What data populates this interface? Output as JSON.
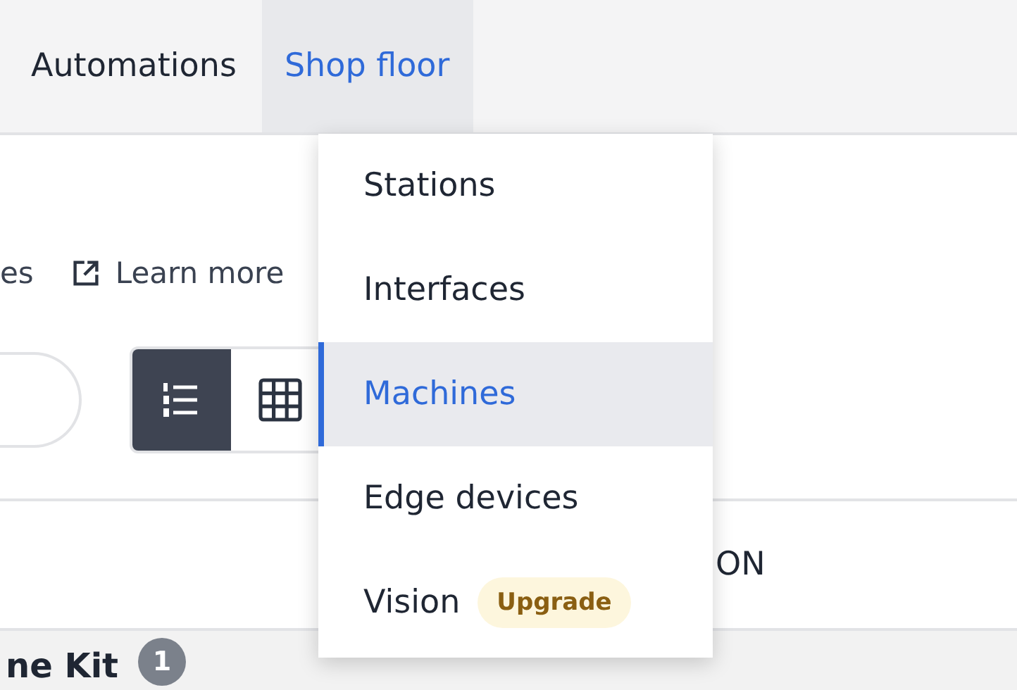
{
  "nav": {
    "tabs": [
      {
        "label": "Automations",
        "selected": false
      },
      {
        "label": "Shop floor",
        "selected": true
      }
    ]
  },
  "toolbar": {
    "text_fragment": "es",
    "link": "Learn more",
    "view_toggle": [
      {
        "kind": "list",
        "selected": true
      },
      {
        "kind": "grid",
        "selected": false
      }
    ]
  },
  "table": {
    "column_fragment": "ON"
  },
  "group": {
    "title": "ne Kit",
    "count": "1"
  },
  "dropdown": {
    "items": [
      {
        "label": "Stations",
        "selected": false
      },
      {
        "label": "Interfaces",
        "selected": false
      },
      {
        "label": "Machines",
        "selected": true
      },
      {
        "label": "Edge devices",
        "selected": false
      },
      {
        "label": "Vision",
        "selected": false,
        "badge": "Upgrade"
      }
    ]
  }
}
